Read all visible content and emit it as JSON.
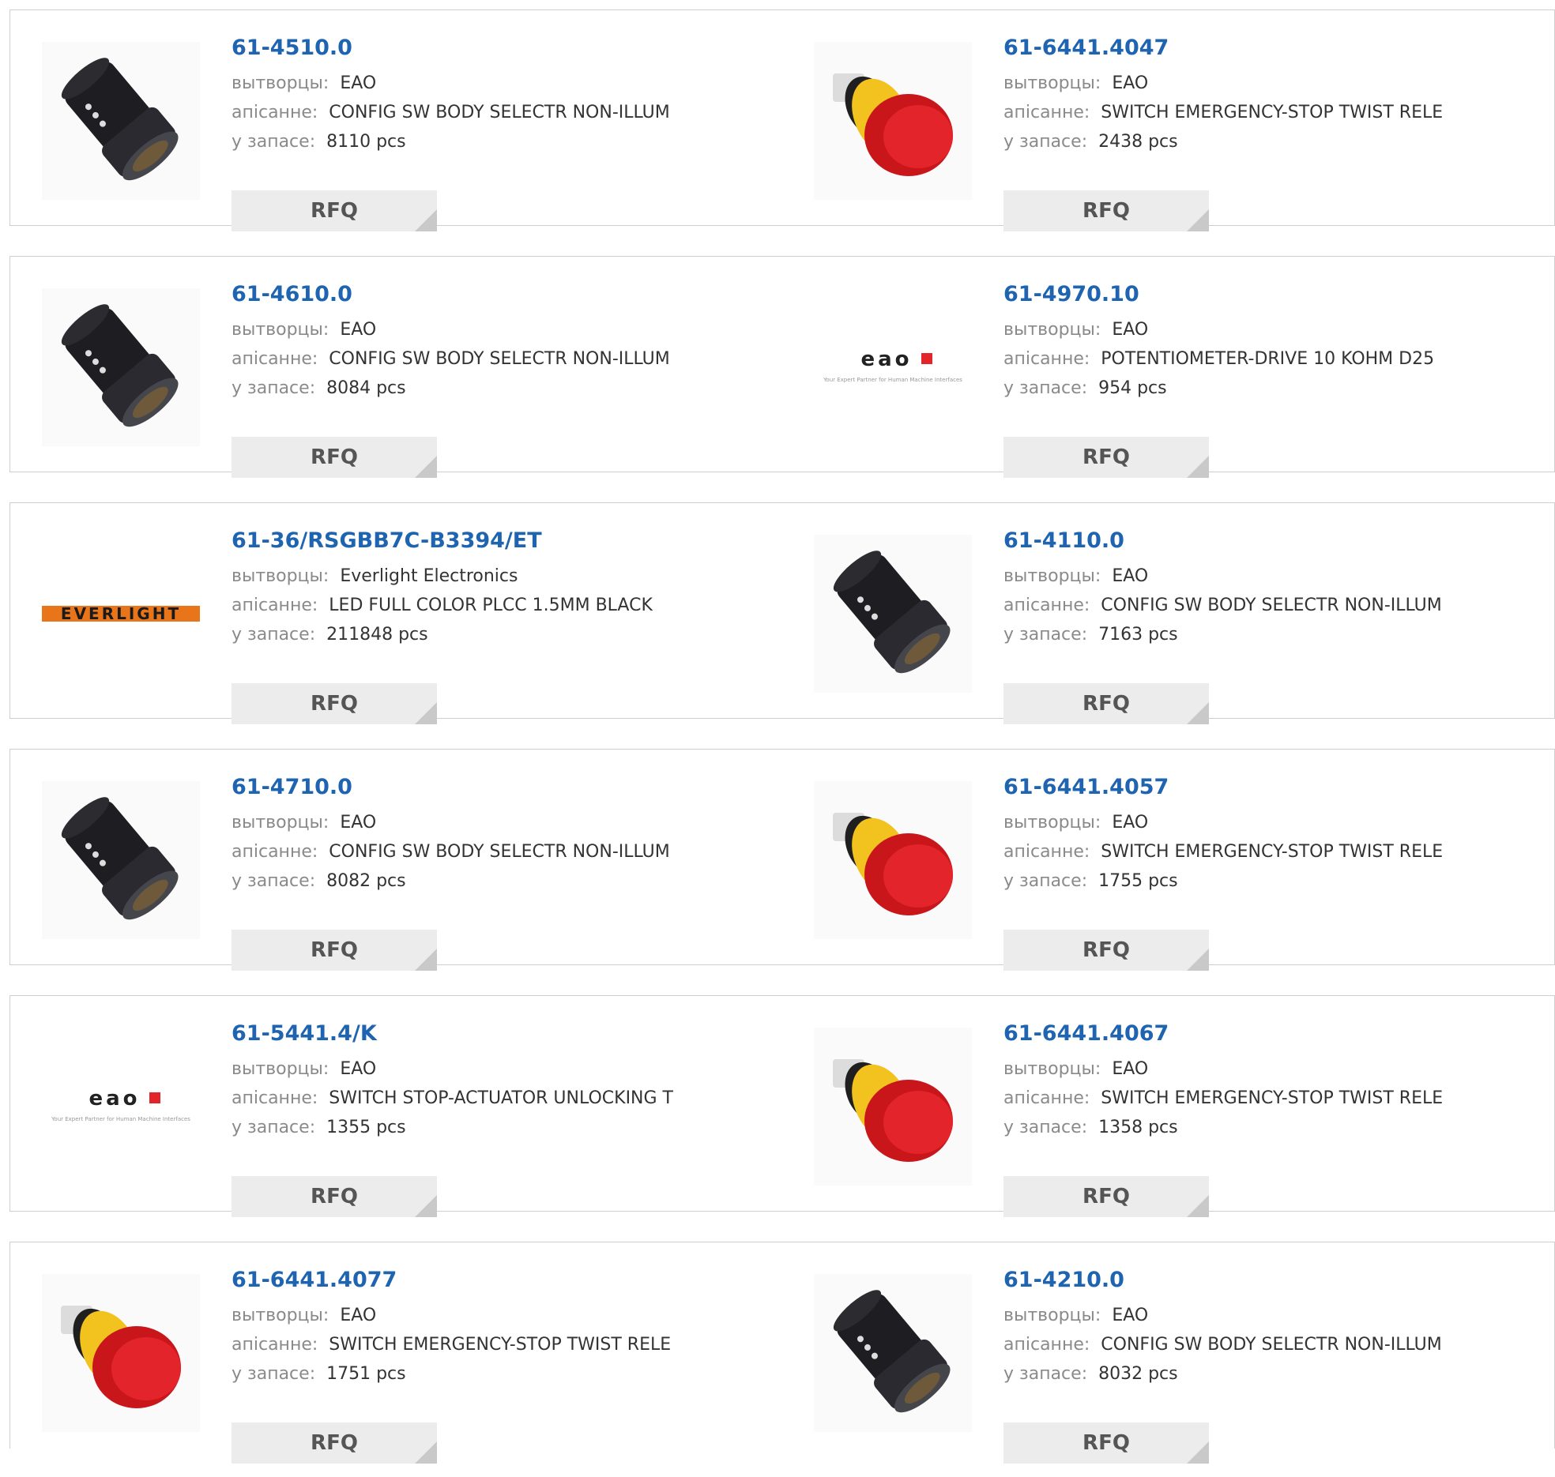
{
  "labels": {
    "manufacturer": "вытворцы:",
    "description": "апісанне:",
    "stock": "у запасе:",
    "rfq": "RFQ"
  },
  "colors": {
    "link": "#1f64b0",
    "label_gray": "#8a8a8a",
    "button_bg": "#ececec",
    "eao_red": "#e3242b",
    "everlight_orange": "#e8751a"
  },
  "products": [
    {
      "part": "61-4510.0",
      "manufacturer": "EAO",
      "description": "CONFIG SW BODY SELECTR NON-ILLUM",
      "stock": "8110 pcs",
      "image": "black-selector-switch-icon"
    },
    {
      "part": "61-6441.4047",
      "manufacturer": "EAO",
      "description": "SWITCH EMERGENCY-STOP TWIST RELE",
      "stock": "2438 pcs",
      "image": "emergency-stop-button-icon"
    },
    {
      "part": "61-4610.0",
      "manufacturer": "EAO",
      "description": "CONFIG SW BODY SELECTR NON-ILLUM",
      "stock": "8084 pcs",
      "image": "black-selector-switch-icon"
    },
    {
      "part": "61-4970.10",
      "manufacturer": "EAO",
      "description": "POTENTIOMETER-DRIVE 10 KOHM D25",
      "stock": "954 pcs",
      "image": "eao-logo"
    },
    {
      "part": "61-36/RSGBB7C-B3394/ET",
      "manufacturer": "Everlight Electronics",
      "description": "LED FULL COLOR PLCC 1.5MM BLACK",
      "stock": "211848 pcs",
      "image": "everlight-logo"
    },
    {
      "part": "61-4110.0",
      "manufacturer": "EAO",
      "description": "CONFIG SW BODY SELECTR NON-ILLUM",
      "stock": "7163 pcs",
      "image": "black-selector-switch-icon"
    },
    {
      "part": "61-4710.0",
      "manufacturer": "EAO",
      "description": "CONFIG SW BODY SELECTR NON-ILLUM",
      "stock": "8082 pcs",
      "image": "black-selector-switch-icon"
    },
    {
      "part": "61-6441.4057",
      "manufacturer": "EAO",
      "description": "SWITCH EMERGENCY-STOP TWIST RELE",
      "stock": "1755 pcs",
      "image": "emergency-stop-button-icon"
    },
    {
      "part": "61-5441.4/K",
      "manufacturer": "EAO",
      "description": "SWITCH STOP-ACTUATOR UNLOCKING T",
      "stock": "1355 pcs",
      "image": "eao-logo"
    },
    {
      "part": "61-6441.4067",
      "manufacturer": "EAO",
      "description": "SWITCH EMERGENCY-STOP TWIST RELE",
      "stock": "1358 pcs",
      "image": "emergency-stop-button-icon"
    },
    {
      "part": "61-6441.4077",
      "manufacturer": "EAO",
      "description": "SWITCH EMERGENCY-STOP TWIST RELE",
      "stock": "1751 pcs",
      "image": "emergency-stop-button-icon"
    },
    {
      "part": "61-4210.0",
      "manufacturer": "EAO",
      "description": "CONFIG SW BODY SELECTR NON-ILLUM",
      "stock": "8032 pcs",
      "image": "black-selector-switch-icon"
    }
  ],
  "brand_logos": {
    "eao": {
      "wordmark": "eao",
      "tagline": "Your Expert Partner for Human Machine Interfaces"
    },
    "everlight": {
      "wordmark": "EVERLIGHT"
    }
  }
}
